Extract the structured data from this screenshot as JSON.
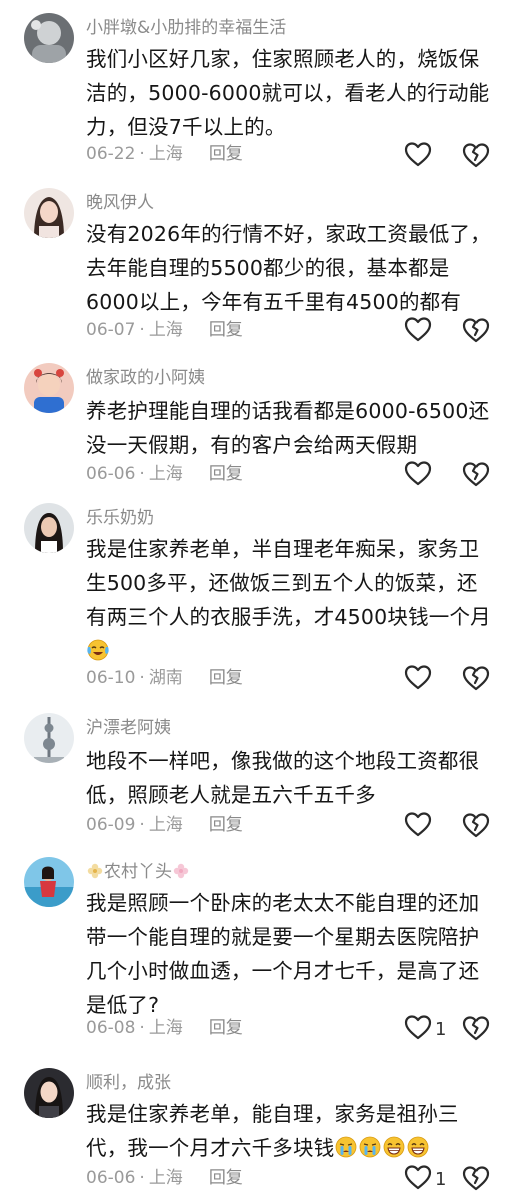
{
  "comments": [
    {
      "username": "小胖墩&小肋排的幸福生活",
      "text": "我们小区好几家，住家照顾老人的，烧饭保洁的，5000-6000就可以，看老人的行动能力，但没7千以上的。",
      "date": "06-22",
      "location": "上海",
      "reply": "回复",
      "likes": ""
    },
    {
      "username": "晚风伊人",
      "text": "没有2026年的行情不好，家政工资最低了，去年能自理的5500都少的很，基本都是6000以上，今年有五千里有4500的都有",
      "date": "06-07",
      "location": "上海",
      "reply": "回复",
      "likes": ""
    },
    {
      "username": "做家政的小阿姨",
      "text": "养老护理能自理的话我看都是6000-6500还没一天假期，有的客户会给两天假期",
      "date": "06-06",
      "location": "上海",
      "reply": "回复",
      "likes": ""
    },
    {
      "username": "乐乐奶奶",
      "text": "我是住家养老单，半自理老年痴呆，家务卫生500多平，还做饭三到五个人的饭菜，还有两三个人的衣服手洗，才4500块钱一个月",
      "emojis": [
        "cry-laugh"
      ],
      "date": "06-10",
      "location": "湖南",
      "reply": "回复",
      "likes": ""
    },
    {
      "username": "沪漂老阿姨",
      "text": "地段不一样吧，像我做的这个地段工资都很低，照顾老人就是五六千五千多",
      "date": "06-09",
      "location": "上海",
      "reply": "回复",
      "likes": ""
    },
    {
      "username": "农村丫头",
      "text": "我是照顾一个卧床的老太太不能自理的还加带一个能自理的就是要一个星期去医院陪护几个小时做血透，一个月才七千，是高了还是低了?",
      "date": "06-08",
      "location": "上海",
      "reply": "回复",
      "likes": "1"
    },
    {
      "username": "顺利，成张",
      "text": "我是住家养老单，能自理，家务是祖孙三代，我一个月才六千多块钱",
      "emojis": [
        "crying",
        "crying",
        "grin",
        "grin"
      ],
      "date": "06-06",
      "location": "上海",
      "reply": "回复",
      "likes": "1"
    }
  ],
  "icons": {
    "like": "heart-outline-icon",
    "dislike": "broken-heart-icon"
  },
  "colors": {
    "meta": "#9a9a9a",
    "username": "#8a8a8a",
    "text": "#161616",
    "emoji": "#f7c331"
  }
}
